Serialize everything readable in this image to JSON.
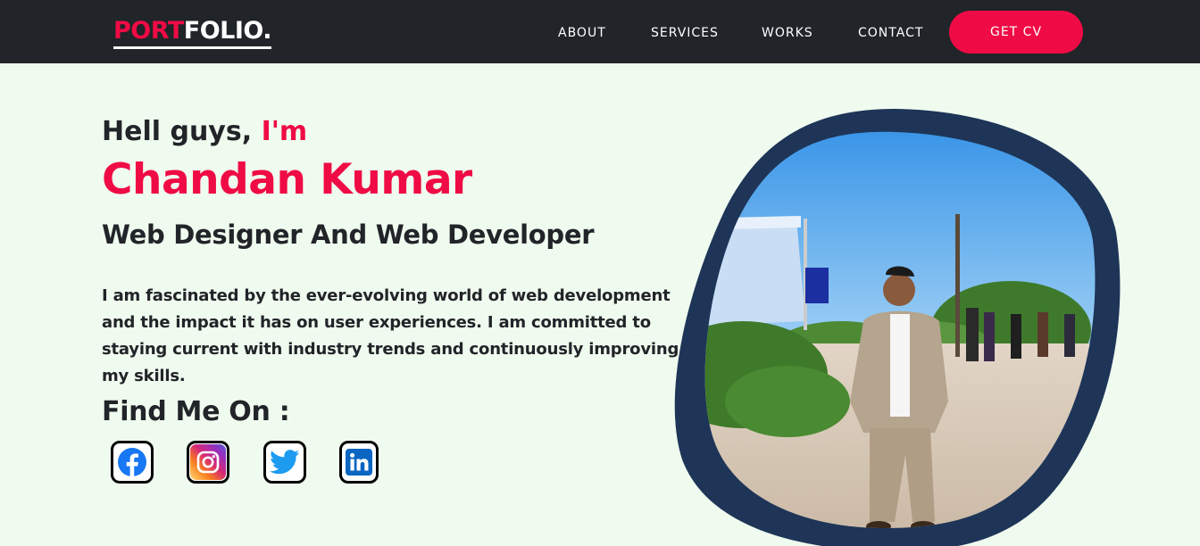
{
  "nav": {
    "logo_part1": "PORT",
    "logo_part2": "FOLIO.",
    "links": [
      "ABOUT",
      "SERVICES",
      "WORKS",
      "CONTACT"
    ],
    "cta": "GET CV"
  },
  "hero": {
    "greeting": "Hell guys,",
    "greeting_accent": "I'm",
    "name": "Chandan Kumar",
    "role": "Web Designer And Web Developer",
    "bio": "I am fascinated by the ever-evolving world of web development and the impact it has on user experiences. I am committed to staying current with industry trends and continuously improving my skills.",
    "find_title": "Find Me On :"
  },
  "social": [
    "facebook-icon",
    "instagram-icon",
    "twitter-icon",
    "linkedin-icon"
  ],
  "colors": {
    "accent": "#ef0b45",
    "navbar": "#212428",
    "background": "#f0fbef",
    "frame": "#1e3558"
  }
}
